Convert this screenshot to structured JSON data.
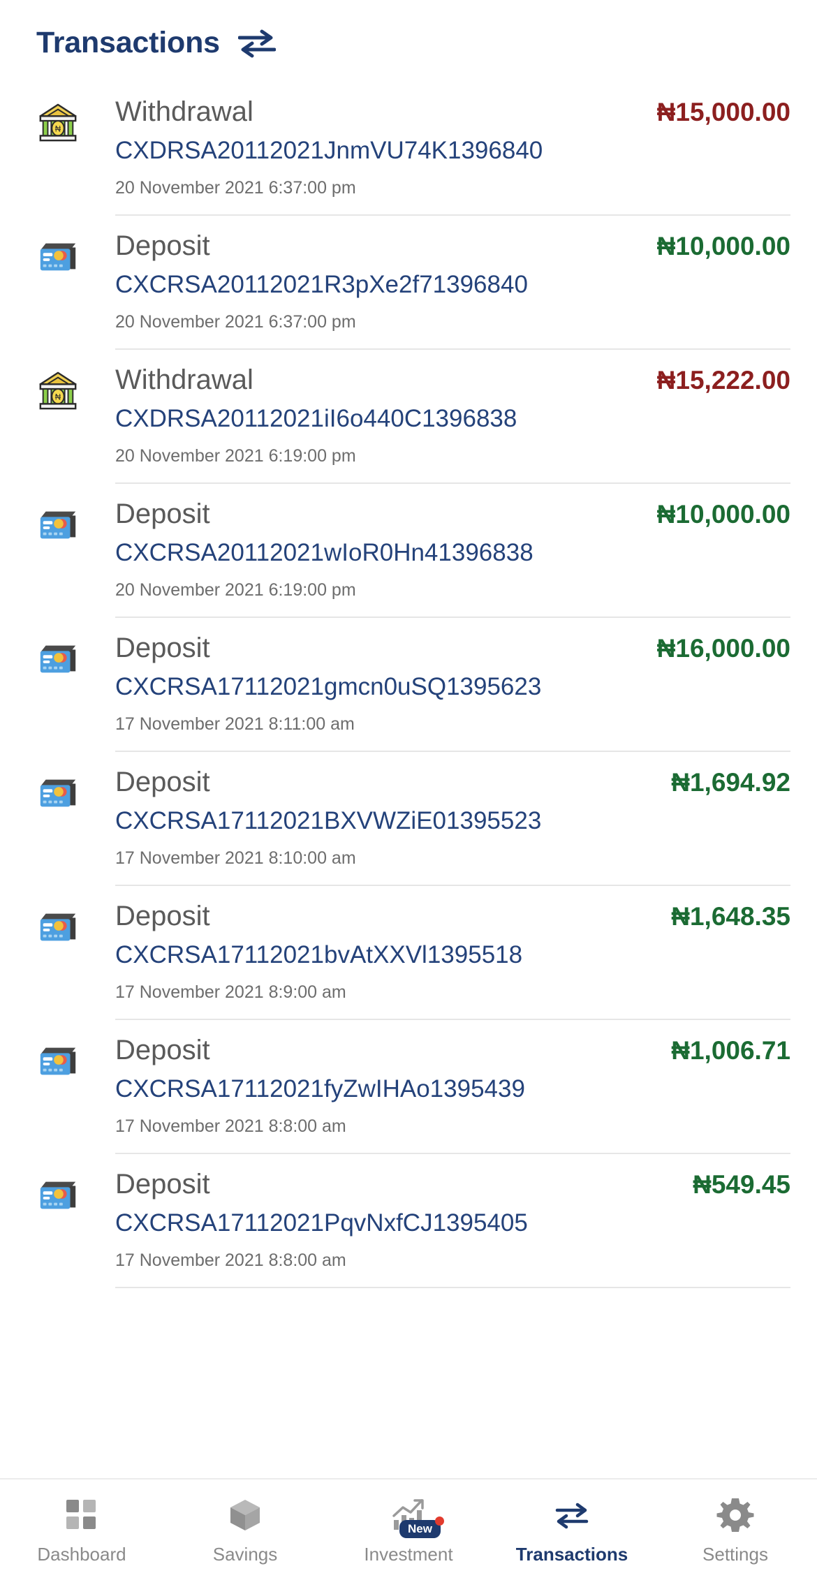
{
  "header": {
    "title": "Transactions",
    "swap_icon": "swap-arrows-icon"
  },
  "colors": {
    "brand_navy": "#1e3a6e",
    "reference_blue": "#24427a",
    "debit_red": "#8c1f1f",
    "credit_green": "#1b6b33",
    "title_gray": "#5a5a5a",
    "date_gray": "#6d6d6d",
    "divider": "#e6e6e6",
    "nav_inactive": "#8a8a8a"
  },
  "transactions": [
    {
      "icon": "bank-building-icon",
      "type": "withdrawal",
      "title": "Withdrawal",
      "reference": "CXDRSA20112021JnmVU74K1396840",
      "date": "20 November 2021 6:37:00 pm",
      "amount": "₦15,000.00",
      "direction": "debit"
    },
    {
      "icon": "credit-card-icon",
      "type": "deposit",
      "title": "Deposit",
      "reference": "CXCRSA20112021R3pXe2f71396840",
      "date": "20 November 2021 6:37:00 pm",
      "amount": "₦10,000.00",
      "direction": "credit"
    },
    {
      "icon": "bank-building-icon",
      "type": "withdrawal",
      "title": "Withdrawal",
      "reference": "CXDRSA20112021iI6o440C1396838",
      "date": "20 November 2021 6:19:00 pm",
      "amount": "₦15,222.00",
      "direction": "debit"
    },
    {
      "icon": "credit-card-icon",
      "type": "deposit",
      "title": "Deposit",
      "reference": "CXCRSA20112021wIoR0Hn41396838",
      "date": "20 November 2021 6:19:00 pm",
      "amount": "₦10,000.00",
      "direction": "credit"
    },
    {
      "icon": "credit-card-icon",
      "type": "deposit",
      "title": "Deposit",
      "reference": "CXCRSA17112021gmcn0uSQ1395623",
      "date": "17 November 2021 8:11:00 am",
      "amount": "₦16,000.00",
      "direction": "credit"
    },
    {
      "icon": "credit-card-icon",
      "type": "deposit",
      "title": "Deposit",
      "reference": "CXCRSA17112021BXVWZiE01395523",
      "date": "17 November 2021 8:10:00 am",
      "amount": "₦1,694.92",
      "direction": "credit"
    },
    {
      "icon": "credit-card-icon",
      "type": "deposit",
      "title": "Deposit",
      "reference": "CXCRSA17112021bvAtXXVl1395518",
      "date": "17 November 2021 8:9:00 am",
      "amount": "₦1,648.35",
      "direction": "credit"
    },
    {
      "icon": "credit-card-icon",
      "type": "deposit",
      "title": "Deposit",
      "reference": "CXCRSA17112021fyZwIHAo1395439",
      "date": "17 November 2021 8:8:00 am",
      "amount": "₦1,006.71",
      "direction": "credit"
    },
    {
      "icon": "credit-card-icon",
      "type": "deposit",
      "title": "Deposit",
      "reference": "CXCRSA17112021PqvNxfCJ1395405",
      "date": "17 November 2021 8:8:00 am",
      "amount": "₦549.45",
      "direction": "credit"
    }
  ],
  "bottom_nav": {
    "items": [
      {
        "label": "Dashboard",
        "icon": "grid-dashboard-icon",
        "active": false,
        "badge": null
      },
      {
        "label": "Savings",
        "icon": "cube-box-icon",
        "active": false,
        "badge": null
      },
      {
        "label": "Investment",
        "icon": "growth-chart-icon",
        "active": false,
        "badge": "New"
      },
      {
        "label": "Transactions",
        "icon": "swap-arrows-icon",
        "active": true,
        "badge": null
      },
      {
        "label": "Settings",
        "icon": "gear-icon",
        "active": false,
        "badge": null
      }
    ]
  }
}
